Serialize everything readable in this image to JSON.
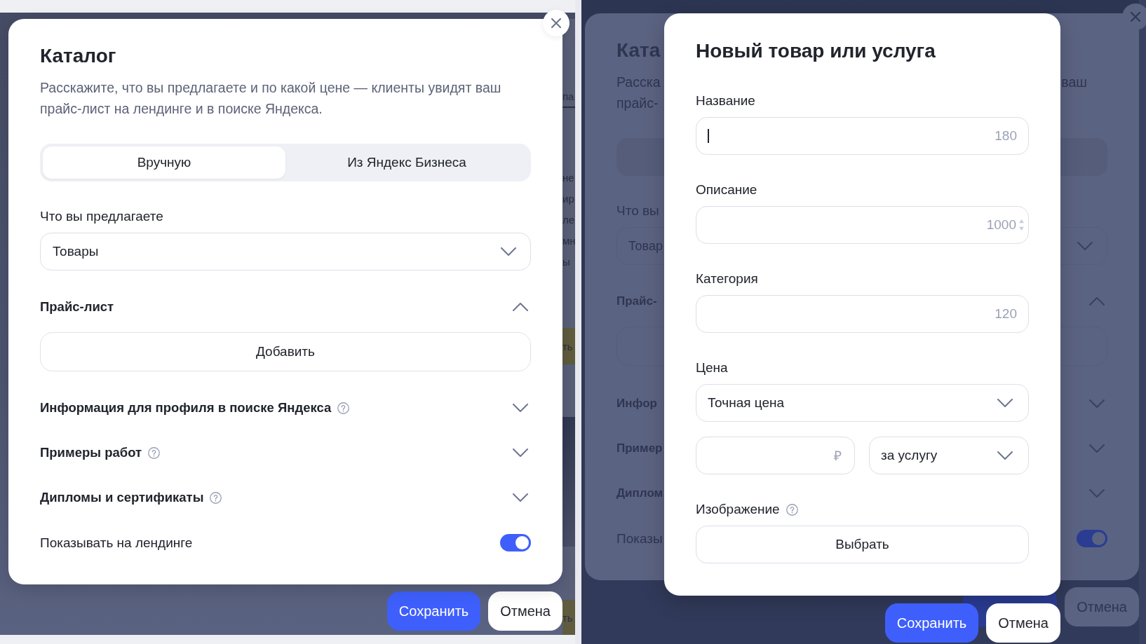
{
  "left_screen": {
    "background_page": {
      "tab_fragment": "па",
      "text_fragments": [
        "не",
        "ир",
        "ле",
        "мн",
        "ы"
      ],
      "button_fragments": [
        "ть",
        "ть"
      ]
    },
    "catalog_dialog": {
      "title": "Каталог",
      "description": "Расскажите, что вы предлагаете и по какой цене — клиенты увидят ваш прайс-лист на лендинге и в поиске Яндекса.",
      "source_tabs": [
        {
          "label": "Вручную",
          "selected": true
        },
        {
          "label": "Из Яндекс Бизнеса",
          "selected": false
        }
      ],
      "offer": {
        "label": "Что вы предлагаете",
        "value": "Товары"
      },
      "sections": [
        {
          "title": "Прайс-лист",
          "help": false,
          "expanded": true,
          "button": "Добавить"
        },
        {
          "title": "Информация для профиля в поиске Яндекса",
          "help": true,
          "expanded": false
        },
        {
          "title": "Примеры работ",
          "help": true,
          "expanded": false
        },
        {
          "title": "Дипломы и сертификаты",
          "help": true,
          "expanded": false
        }
      ],
      "landing_toggle": {
        "label": "Показывать на лендинге",
        "on": true
      }
    },
    "footer_buttons": [
      {
        "label": "Сохранить",
        "kind": "primary"
      },
      {
        "label": "Отмена",
        "kind": "secondary"
      }
    ]
  },
  "right_screen": {
    "dimmed_catalog": {
      "title": "Ката",
      "description": {
        "line_1_start": "Расска",
        "line_1_end": "ваш",
        "line_2_start": "прайс-"
      },
      "offer": {
        "label": "Что вы",
        "value": "Товар"
      },
      "sections": [
        {
          "title": "Прайс-",
          "expanded": true
        },
        {
          "title": "Инфор",
          "expanded": false
        },
        {
          "title": "Пример",
          "expanded": false
        },
        {
          "title": "Диплом",
          "expanded": false
        }
      ],
      "landing_toggle": {
        "label": "Показы",
        "on": true
      },
      "footer_buttons": [
        {
          "kind": "primary"
        },
        {
          "label": "Отмена",
          "kind": "secondary"
        }
      ]
    },
    "new_item_dialog": {
      "title": "Новый товар или услуга",
      "fields": [
        {
          "kind": "text",
          "label": "Название",
          "counter": "180",
          "focused": true
        },
        {
          "kind": "textarea",
          "label": "Описание",
          "counter": "1000",
          "focused": false
        },
        {
          "kind": "text",
          "label": "Категория",
          "counter": "120",
          "focused": false
        },
        {
          "kind": "select",
          "label": "Цена",
          "value": "Точная цена"
        },
        {
          "kind": "price",
          "currency": "₽",
          "unit": "за услугу"
        },
        {
          "kind": "upload",
          "label": "Изображение",
          "help": true,
          "button": "Выбрать"
        }
      ]
    },
    "footer_buttons": [
      {
        "label": "Сохранить",
        "kind": "primary"
      },
      {
        "label": "Отмена",
        "kind": "secondary"
      }
    ]
  }
}
